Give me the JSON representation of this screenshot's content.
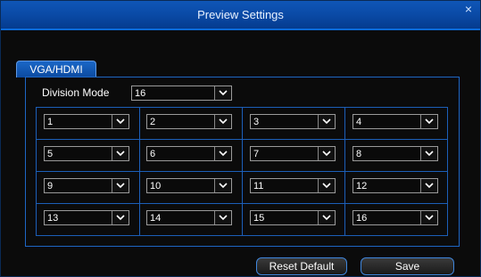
{
  "window": {
    "title": "Preview Settings",
    "close_symbol": "×"
  },
  "tab": {
    "label": "VGA/HDMI"
  },
  "division": {
    "label": "Division Mode",
    "value": "16"
  },
  "channels": [
    "1",
    "2",
    "3",
    "4",
    "5",
    "6",
    "7",
    "8",
    "9",
    "10",
    "11",
    "12",
    "13",
    "14",
    "15",
    "16"
  ],
  "buttons": {
    "reset": "Reset Default",
    "save": "Save"
  },
  "colors": {
    "accent": "#0b6ad8",
    "title_bar": "#0a4aa6",
    "background": "#0b0b0b"
  }
}
